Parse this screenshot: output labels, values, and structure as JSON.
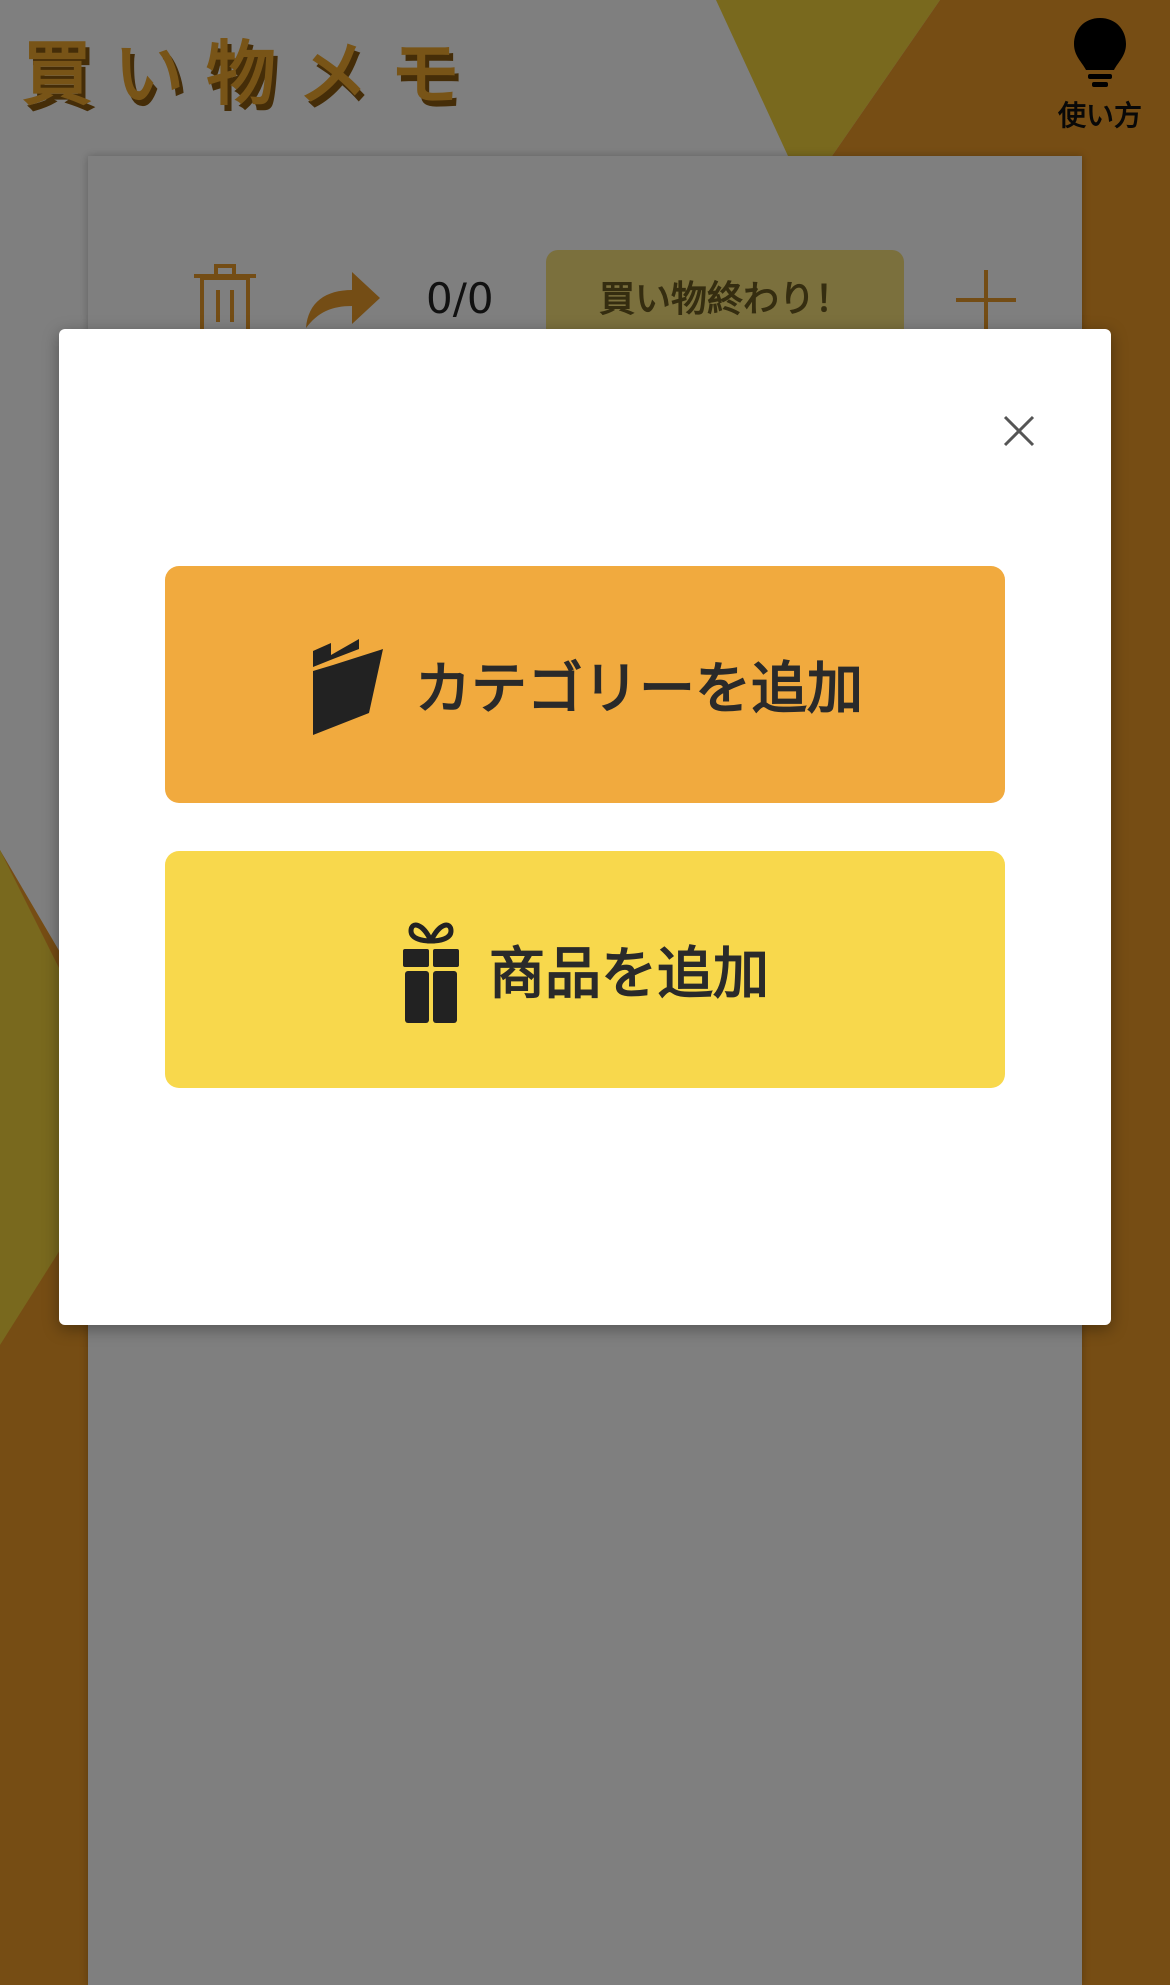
{
  "app": {
    "title": "買い物メモ",
    "help_label": "使い方"
  },
  "toolbar": {
    "counter": "0/0",
    "finish_label": "買い物終わり！"
  },
  "modal": {
    "add_category_label": "カテゴリーを追加",
    "add_product_label": "商品を追加"
  },
  "colors": {
    "orange": "#f1aa3e",
    "yellow": "#f8d84c",
    "brown": "#a86a17",
    "olive": "#f2d23c"
  }
}
